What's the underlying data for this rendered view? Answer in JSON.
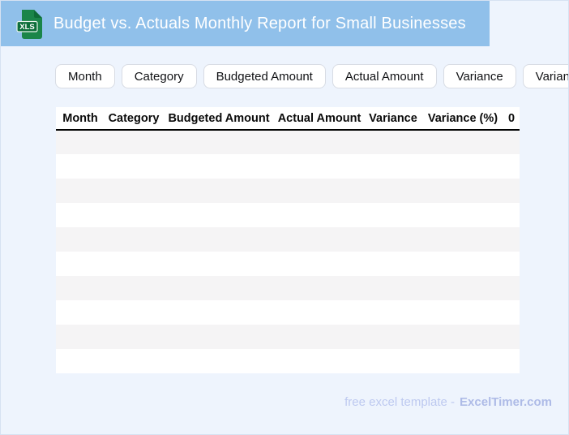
{
  "header": {
    "title": "Budget vs. Actuals Monthly Report for Small Businesses",
    "file_icon": {
      "name": "xls-file-icon",
      "badge_label": "XLS"
    }
  },
  "chips": [
    {
      "label": "Month"
    },
    {
      "label": "Category"
    },
    {
      "label": "Budgeted Amount"
    },
    {
      "label": "Actual Amount"
    },
    {
      "label": "Variance"
    },
    {
      "label": "Variance (%)"
    }
  ],
  "table": {
    "columns": [
      "Month",
      "Category",
      "Budgeted Amount",
      "Actual Amount",
      "Variance",
      "Variance (%)",
      "0"
    ],
    "row_count": 10,
    "rows": [
      [
        "",
        "",
        "",
        "",
        "",
        "",
        ""
      ],
      [
        "",
        "",
        "",
        "",
        "",
        "",
        ""
      ],
      [
        "",
        "",
        "",
        "",
        "",
        "",
        ""
      ],
      [
        "",
        "",
        "",
        "",
        "",
        "",
        ""
      ],
      [
        "",
        "",
        "",
        "",
        "",
        "",
        ""
      ],
      [
        "",
        "",
        "",
        "",
        "",
        "",
        ""
      ],
      [
        "",
        "",
        "",
        "",
        "",
        "",
        ""
      ],
      [
        "",
        "",
        "",
        "",
        "",
        "",
        ""
      ],
      [
        "",
        "",
        "",
        "",
        "",
        "",
        ""
      ],
      [
        "",
        "",
        "",
        "",
        "",
        "",
        ""
      ]
    ]
  },
  "footer": {
    "text": "free excel template -",
    "brand": "ExcelTimer.com"
  },
  "colors": {
    "header_bar": "#90c0ea",
    "page_background": "#eef4fd",
    "icon_document_green": "#1a8549",
    "icon_fold_green": "#0e6b38",
    "icon_badge_green": "#0d6e3a",
    "row_stripe": "#f5f4f5",
    "table_header_rule": "#000000",
    "footer_text": "#bdc9f0",
    "footer_brand": "#aebbe7"
  }
}
